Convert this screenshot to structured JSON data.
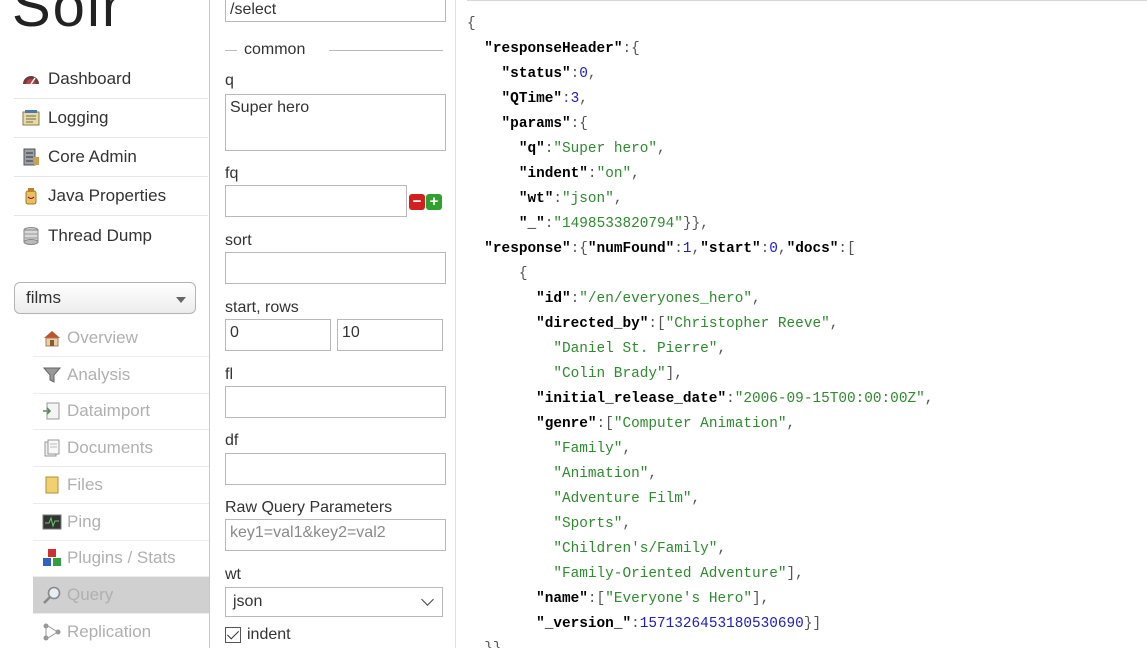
{
  "app": {
    "logo_text": "Solr"
  },
  "sidebar": {
    "items": [
      {
        "label": "Dashboard",
        "icon": "dashboard-icon"
      },
      {
        "label": "Logging",
        "icon": "logging-icon"
      },
      {
        "label": "Core Admin",
        "icon": "core-admin-icon"
      },
      {
        "label": "Java Properties",
        "icon": "java-properties-icon"
      },
      {
        "label": "Thread Dump",
        "icon": "thread-dump-icon"
      }
    ],
    "core_selector": {
      "value": "films"
    },
    "core_items": [
      {
        "label": "Overview",
        "icon": "house-icon"
      },
      {
        "label": "Analysis",
        "icon": "funnel-icon"
      },
      {
        "label": "Dataimport",
        "icon": "dataimport-icon"
      },
      {
        "label": "Documents",
        "icon": "documents-icon"
      },
      {
        "label": "Files",
        "icon": "files-icon"
      },
      {
        "label": "Ping",
        "icon": "ping-icon"
      },
      {
        "label": "Plugins / Stats",
        "icon": "plugins-icon"
      },
      {
        "label": "Query",
        "icon": "magnifier-icon",
        "active": true
      },
      {
        "label": "Replication",
        "icon": "replication-icon"
      }
    ]
  },
  "form": {
    "request_handler": "/select",
    "section_legend": "common",
    "q": {
      "label": "q",
      "value": "Super hero"
    },
    "fq": {
      "label": "fq",
      "value": ""
    },
    "sort": {
      "label": "sort",
      "value": ""
    },
    "start_rows": {
      "label": "start, rows",
      "start": "0",
      "rows": "10"
    },
    "fl": {
      "label": "fl",
      "value": ""
    },
    "df": {
      "label": "df",
      "value": ""
    },
    "raw": {
      "label": "Raw Query Parameters",
      "placeholder": "key1=val1&key2=val2"
    },
    "wt": {
      "label": "wt",
      "value": "json"
    },
    "indent": {
      "label": "indent",
      "checked": true
    }
  },
  "response_lines": [
    [
      [
        "p",
        "{"
      ]
    ],
    [
      [
        "p",
        "  "
      ],
      [
        "k",
        "\"responseHeader\""
      ],
      [
        "p",
        ":{"
      ]
    ],
    [
      [
        "p",
        "    "
      ],
      [
        "k",
        "\"status\""
      ],
      [
        "p",
        ":"
      ],
      [
        "n",
        "0"
      ],
      [
        "p",
        ","
      ]
    ],
    [
      [
        "p",
        "    "
      ],
      [
        "k",
        "\"QTime\""
      ],
      [
        "p",
        ":"
      ],
      [
        "n",
        "3"
      ],
      [
        "p",
        ","
      ]
    ],
    [
      [
        "p",
        "    "
      ],
      [
        "k",
        "\"params\""
      ],
      [
        "p",
        ":{"
      ]
    ],
    [
      [
        "p",
        "      "
      ],
      [
        "k",
        "\"q\""
      ],
      [
        "p",
        ":"
      ],
      [
        "s",
        "\"Super hero\""
      ],
      [
        "p",
        ","
      ]
    ],
    [
      [
        "p",
        "      "
      ],
      [
        "k",
        "\"indent\""
      ],
      [
        "p",
        ":"
      ],
      [
        "s",
        "\"on\""
      ],
      [
        "p",
        ","
      ]
    ],
    [
      [
        "p",
        "      "
      ],
      [
        "k",
        "\"wt\""
      ],
      [
        "p",
        ":"
      ],
      [
        "s",
        "\"json\""
      ],
      [
        "p",
        ","
      ]
    ],
    [
      [
        "p",
        "      "
      ],
      [
        "k",
        "\"_\""
      ],
      [
        "p",
        ":"
      ],
      [
        "s",
        "\"1498533820794\""
      ],
      [
        "p",
        "}},"
      ]
    ],
    [
      [
        "p",
        "  "
      ],
      [
        "k",
        "\"response\""
      ],
      [
        "p",
        ":{"
      ],
      [
        "k",
        "\"numFound\""
      ],
      [
        "p",
        ":"
      ],
      [
        "n",
        "1"
      ],
      [
        "p",
        ","
      ],
      [
        "k",
        "\"start\""
      ],
      [
        "p",
        ":"
      ],
      [
        "n",
        "0"
      ],
      [
        "p",
        ","
      ],
      [
        "k",
        "\"docs\""
      ],
      [
        "p",
        ":["
      ]
    ],
    [
      [
        "p",
        "      {"
      ]
    ],
    [
      [
        "p",
        "        "
      ],
      [
        "k",
        "\"id\""
      ],
      [
        "p",
        ":"
      ],
      [
        "s",
        "\"/en/everyones_hero\""
      ],
      [
        "p",
        ","
      ]
    ],
    [
      [
        "p",
        "        "
      ],
      [
        "k",
        "\"directed_by\""
      ],
      [
        "p",
        ":["
      ],
      [
        "s",
        "\"Christopher Reeve\""
      ],
      [
        "p",
        ","
      ]
    ],
    [
      [
        "p",
        "          "
      ],
      [
        "s",
        "\"Daniel St. Pierre\""
      ],
      [
        "p",
        ","
      ]
    ],
    [
      [
        "p",
        "          "
      ],
      [
        "s",
        "\"Colin Brady\""
      ],
      [
        "p",
        "],"
      ]
    ],
    [
      [
        "p",
        "        "
      ],
      [
        "k",
        "\"initial_release_date\""
      ],
      [
        "p",
        ":"
      ],
      [
        "s",
        "\"2006-09-15T00:00:00Z\""
      ],
      [
        "p",
        ","
      ]
    ],
    [
      [
        "p",
        "        "
      ],
      [
        "k",
        "\"genre\""
      ],
      [
        "p",
        ":["
      ],
      [
        "s",
        "\"Computer Animation\""
      ],
      [
        "p",
        ","
      ]
    ],
    [
      [
        "p",
        "          "
      ],
      [
        "s",
        "\"Family\""
      ],
      [
        "p",
        ","
      ]
    ],
    [
      [
        "p",
        "          "
      ],
      [
        "s",
        "\"Animation\""
      ],
      [
        "p",
        ","
      ]
    ],
    [
      [
        "p",
        "          "
      ],
      [
        "s",
        "\"Adventure Film\""
      ],
      [
        "p",
        ","
      ]
    ],
    [
      [
        "p",
        "          "
      ],
      [
        "s",
        "\"Sports\""
      ],
      [
        "p",
        ","
      ]
    ],
    [
      [
        "p",
        "          "
      ],
      [
        "s",
        "\"Children's/Family\""
      ],
      [
        "p",
        ","
      ]
    ],
    [
      [
        "p",
        "          "
      ],
      [
        "s",
        "\"Family-Oriented Adventure\""
      ],
      [
        "p",
        "],"
      ]
    ],
    [
      [
        "p",
        "        "
      ],
      [
        "k",
        "\"name\""
      ],
      [
        "p",
        ":["
      ],
      [
        "s",
        "\"Everyone's Hero\""
      ],
      [
        "p",
        "],"
      ]
    ],
    [
      [
        "p",
        "        "
      ],
      [
        "k",
        "\"_version_\""
      ],
      [
        "p",
        ":"
      ],
      [
        "n",
        "1571326453180530690"
      ],
      [
        "p",
        "}]"
      ]
    ],
    [
      [
        "p",
        "  }}"
      ]
    ]
  ]
}
